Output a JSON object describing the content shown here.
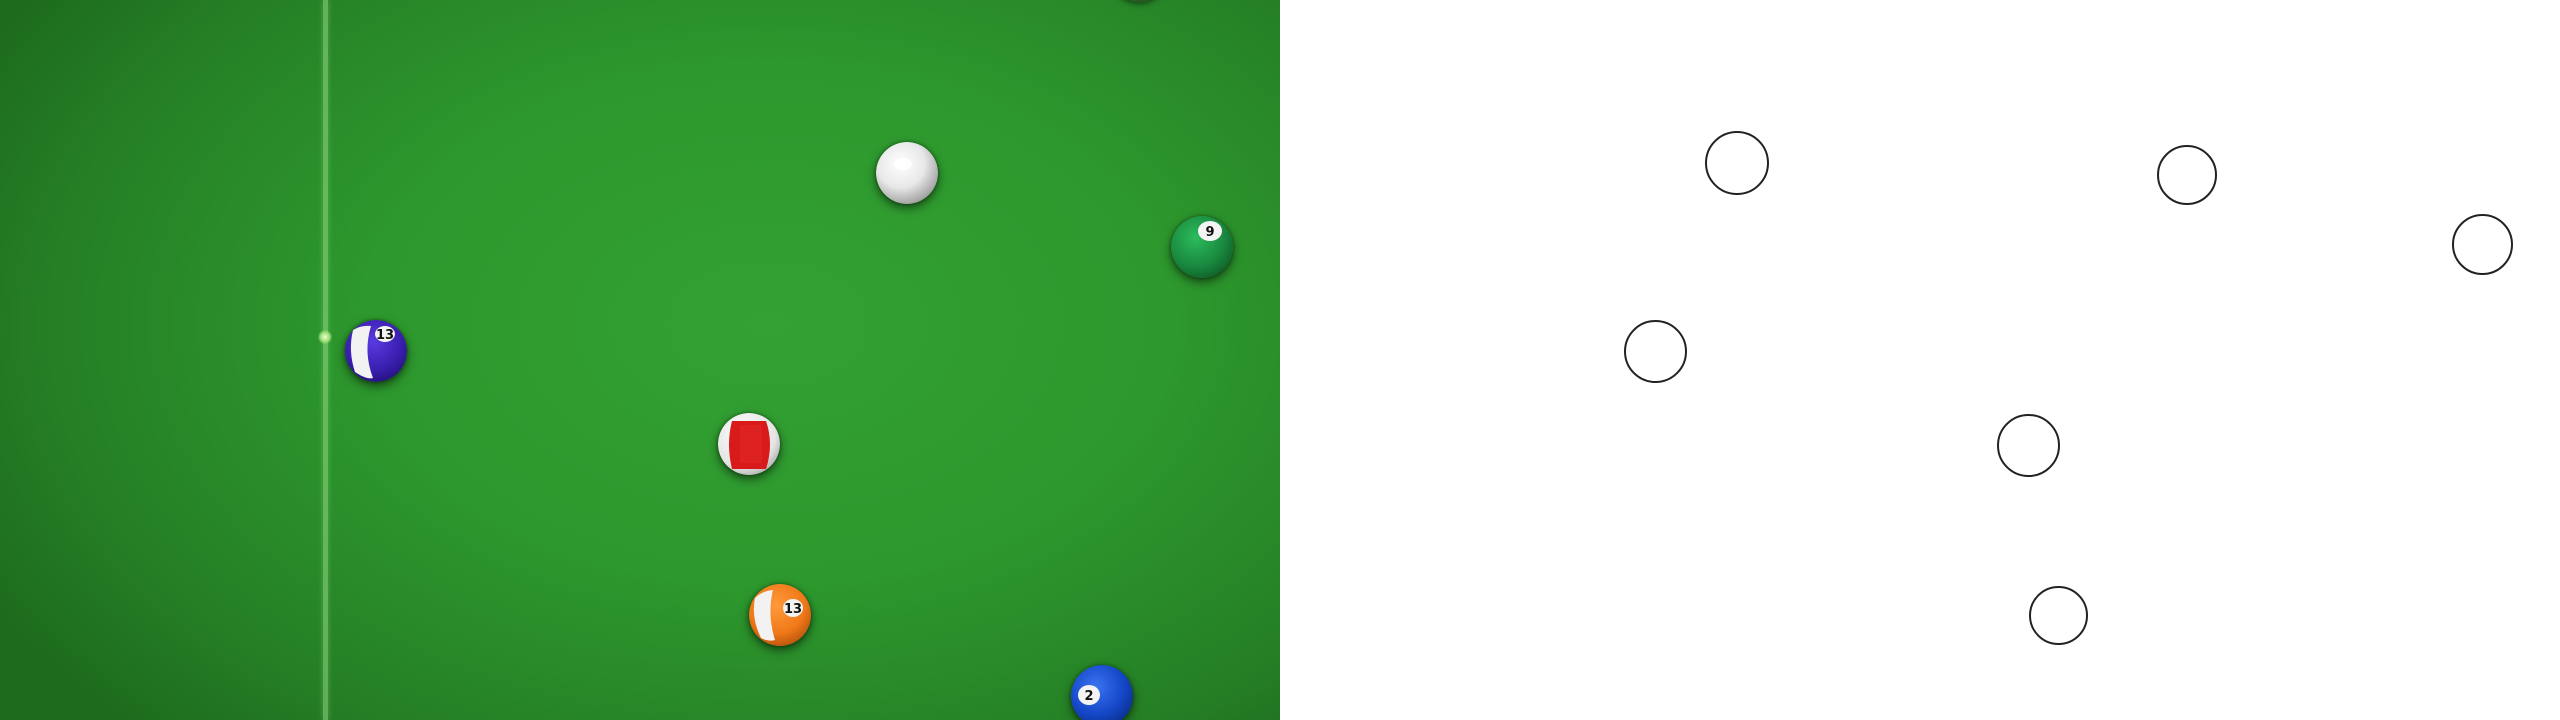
{
  "colors": {
    "felt": "#2d982d",
    "head_string": "#a6e896",
    "outline_stroke": "#222222"
  },
  "balls": [
    {
      "id": "cue",
      "type": "cue",
      "color": "#f2f2f2",
      "number": ""
    },
    {
      "id": "ball-9",
      "type": "stripe",
      "color": "#1e9a4a",
      "number": "9"
    },
    {
      "id": "ball-13",
      "type": "stripe",
      "color": "#3a1fb0",
      "number": "13"
    },
    {
      "id": "ball-3",
      "type": "solid-stripe",
      "color": "#d91a1a",
      "number": ""
    },
    {
      "id": "ball-13b",
      "type": "stripe",
      "color": "#f07818",
      "number": "13"
    },
    {
      "id": "ball-2",
      "type": "solid",
      "color": "#1447c8",
      "number": "2"
    }
  ]
}
